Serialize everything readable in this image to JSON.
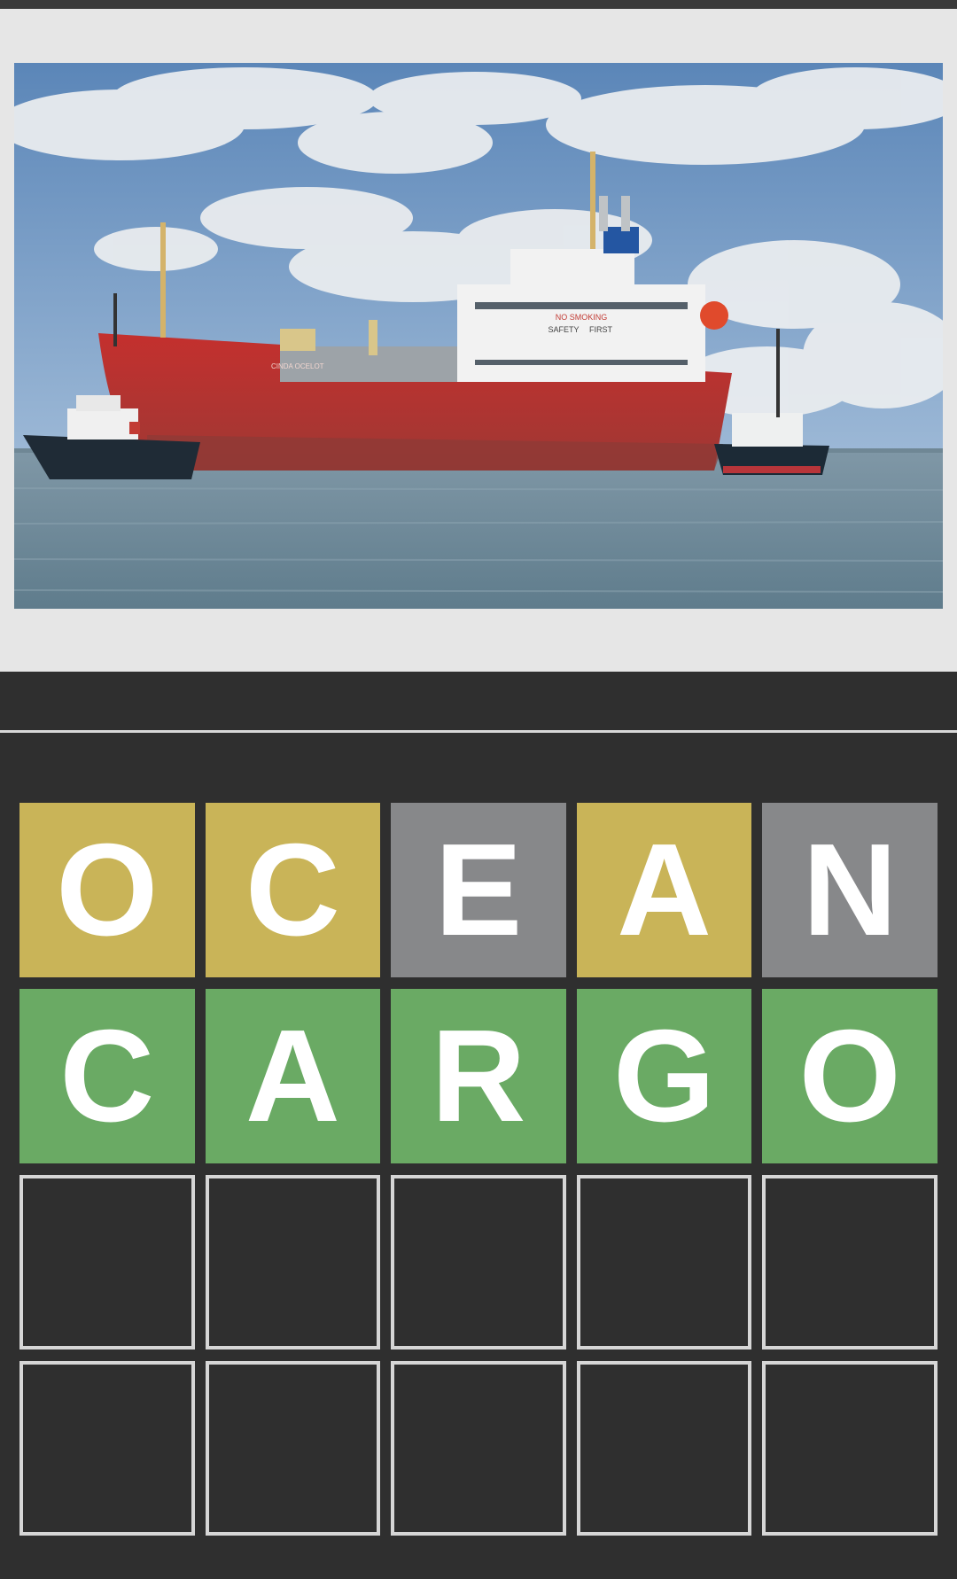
{
  "photo": {
    "hull_text": "CINDA OCELOT",
    "sign_line_1": "NO SMOKING",
    "sign_line_2": "SAFETY",
    "sign_line_3": "FIRST"
  },
  "board": {
    "rows": [
      {
        "tiles": [
          {
            "letter": "O",
            "state": "present"
          },
          {
            "letter": "C",
            "state": "present"
          },
          {
            "letter": "E",
            "state": "absent"
          },
          {
            "letter": "A",
            "state": "present"
          },
          {
            "letter": "N",
            "state": "absent"
          }
        ]
      },
      {
        "tiles": [
          {
            "letter": "C",
            "state": "correct"
          },
          {
            "letter": "A",
            "state": "correct"
          },
          {
            "letter": "R",
            "state": "correct"
          },
          {
            "letter": "G",
            "state": "correct"
          },
          {
            "letter": "O",
            "state": "correct"
          }
        ]
      },
      {
        "tiles": [
          {
            "letter": "",
            "state": "empty"
          },
          {
            "letter": "",
            "state": "empty"
          },
          {
            "letter": "",
            "state": "empty"
          },
          {
            "letter": "",
            "state": "empty"
          },
          {
            "letter": "",
            "state": "empty"
          }
        ]
      },
      {
        "tiles": [
          {
            "letter": "",
            "state": "empty"
          },
          {
            "letter": "",
            "state": "empty"
          },
          {
            "letter": "",
            "state": "empty"
          },
          {
            "letter": "",
            "state": "empty"
          },
          {
            "letter": "",
            "state": "empty"
          }
        ]
      }
    ]
  },
  "colors": {
    "present": "#c9b458",
    "absent": "#87888a",
    "correct": "#6aaa64",
    "background": "#2f2f2f",
    "empty_border": "#d6d6d6"
  }
}
